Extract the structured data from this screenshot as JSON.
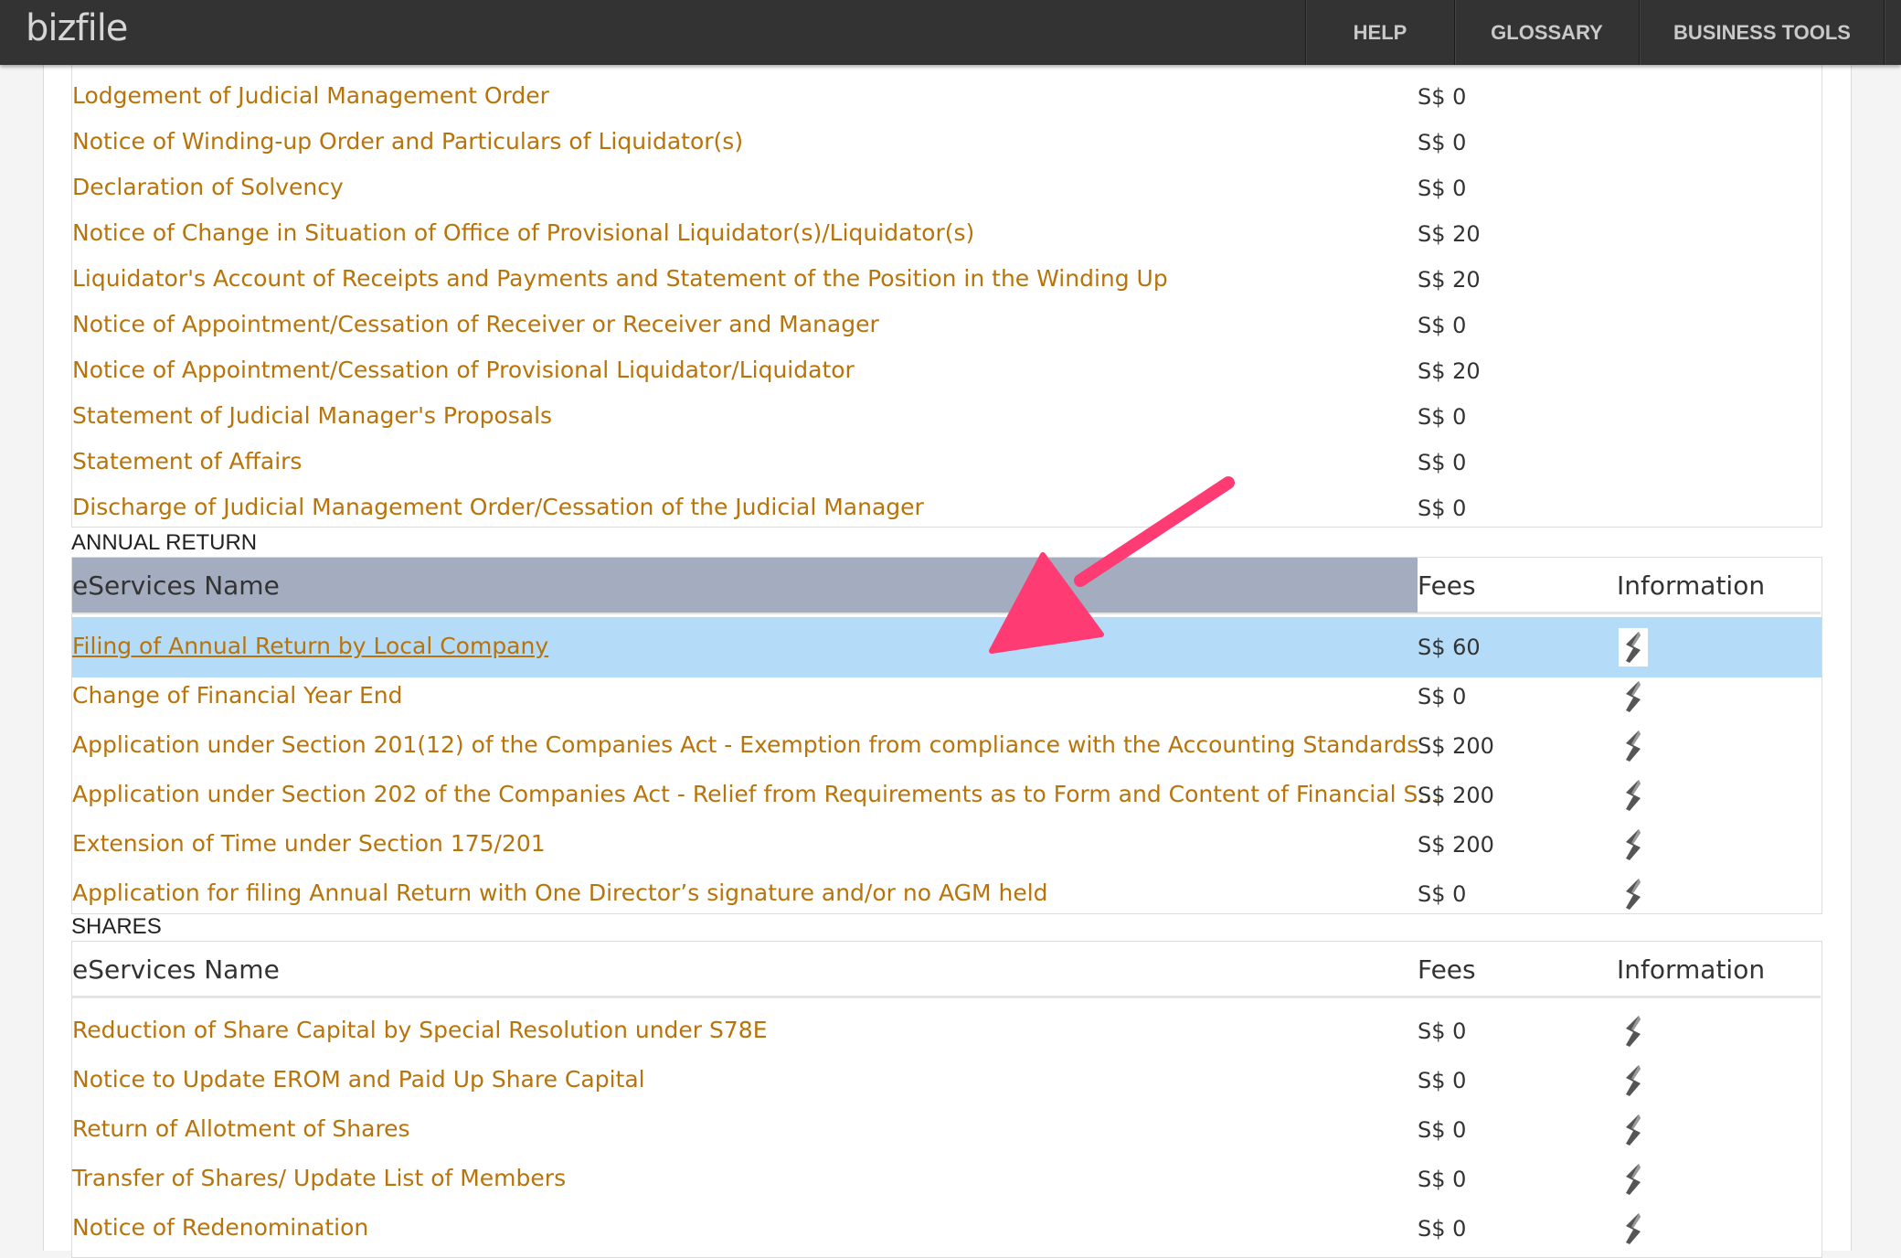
{
  "header": {
    "logo": "bizfile",
    "nav": [
      "HELP",
      "GLOSSARY",
      "BUSINESS TOOLS"
    ]
  },
  "winding_up_rows": [
    {
      "name": "Lodgement of Judicial Management Order",
      "fee": "S$ 0"
    },
    {
      "name": "Notice of Winding-up Order and Particulars of Liquidator(s)",
      "fee": "S$ 0"
    },
    {
      "name": "Declaration of Solvency",
      "fee": "S$ 0"
    },
    {
      "name": "Notice of Change in Situation of Office of Provisional Liquidator(s)/Liquidator(s)",
      "fee": "S$ 20"
    },
    {
      "name": "Liquidator's Account of Receipts and Payments and Statement of the Position in the Winding Up",
      "fee": "S$ 20"
    },
    {
      "name": "Notice of Appointment/Cessation of Receiver or Receiver and Manager",
      "fee": "S$ 0"
    },
    {
      "name": "Notice of Appointment/Cessation of Provisional Liquidator/Liquidator",
      "fee": "S$ 20"
    },
    {
      "name": "Statement of Judicial Manager's Proposals",
      "fee": "S$ 0"
    },
    {
      "name": "Statement of Affairs",
      "fee": "S$ 0"
    },
    {
      "name": "Discharge of Judicial Management Order/Cessation of the Judicial Manager",
      "fee": "S$ 0"
    }
  ],
  "annual_return": {
    "title": "ANNUAL RETURN",
    "headers": {
      "name": "eServices Name",
      "fees": "Fees",
      "info": "Information"
    },
    "rows": [
      {
        "name": "Filing of Annual Return by Local Company",
        "fee": "S$ 60"
      },
      {
        "name": "Change of Financial Year End",
        "fee": "S$ 0"
      },
      {
        "name": "Application under Section 201(12) of the Companies Act - Exemption from compliance with the Accounting Standards",
        "fee": "S$ 200"
      },
      {
        "name": "Application under Section 202 of the Companies Act - Relief from Requirements as to Form and Content of Financial S...",
        "fee": "S$ 200"
      },
      {
        "name": "Extension of Time under Section 175/201",
        "fee": "S$ 200"
      },
      {
        "name": "Application for filing Annual Return with One Director’s signature and/or no AGM held",
        "fee": "S$ 0"
      }
    ]
  },
  "shares": {
    "title": "SHARES",
    "headers": {
      "name": "eServices Name",
      "fees": "Fees",
      "info": "Information"
    },
    "rows": [
      {
        "name": "Reduction of Share Capital by Special Resolution under S78E",
        "fee": "S$ 0"
      },
      {
        "name": "Notice to Update EROM and Paid Up Share Capital",
        "fee": "S$ 0"
      },
      {
        "name": "Return of Allotment of Shares",
        "fee": "S$ 0"
      },
      {
        "name": "Transfer of Shares/ Update List of Members",
        "fee": "S$ 0"
      },
      {
        "name": "Notice of Redenomination",
        "fee": "S$ 0"
      }
    ]
  },
  "colors": {
    "link": "#b8740a",
    "header_bar": "#333333",
    "highlight_row": "#b4dbf7",
    "sorted_header": "#a3adbf",
    "annotation_arrow": "#ff3b74"
  }
}
